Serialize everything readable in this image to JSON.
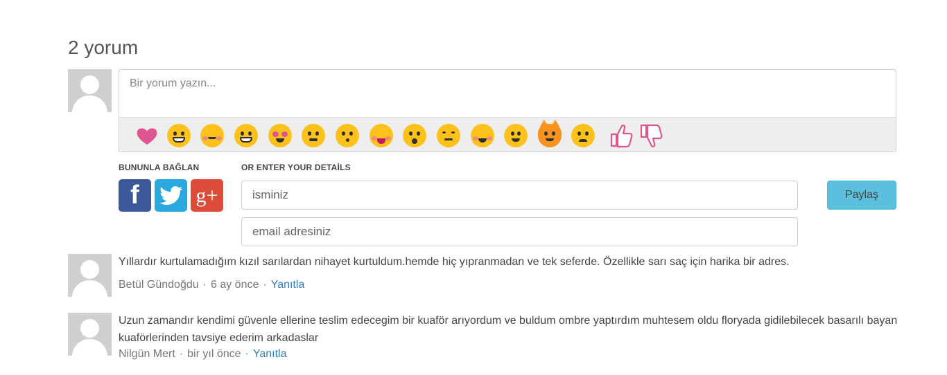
{
  "header": {
    "title": "2 yorum"
  },
  "compose": {
    "placeholder": "Bir yorum yazın...",
    "emojis": [
      "heart-icon",
      "anguished-face-icon",
      "sleepy-face-icon",
      "grinning-face-icon",
      "heart-eyes-face-icon",
      "confounded-face-icon",
      "kissing-face-icon",
      "laughing-face-icon",
      "surprised-face-icon",
      "angry-face-icon",
      "blushing-face-icon",
      "smiling-face-icon",
      "cat-face-icon",
      "worried-face-icon",
      "thumbs-up-icon",
      "thumbs-down-icon"
    ]
  },
  "connect": {
    "social_label": "BUNUNLA BAĞLAN",
    "details_label": "OR ENTER YOUR DETAİLS",
    "facebook_glyph": "f",
    "google_glyph": "g+"
  },
  "form": {
    "name_placeholder": "isminiz",
    "email_placeholder": "email adresiniz",
    "submit_label": "Paylaş"
  },
  "comments": [
    {
      "text": "Yıllardır kurtulamadığım kızıl sarılardan nihayet kurtuldum.hemde hiç yıpranmadan ve tek seferde. Özellikle sarı saç için harika bir adres.",
      "author": "Betül Gündoğdu",
      "time": "6 ay önce",
      "reply": "Yanıtla"
    },
    {
      "text": "Uzun zamandır kendimi güvenle ellerine teslim edecegim bir kuaför arıyordum ve buldum ombre yaptırdım muhtesem oldu floryada gidilebilecek basarılı bayan kuaförlerinden tavsiye ederim arkadaslar",
      "author": "Nilgün Mert",
      "time": "bir yıl önce",
      "reply": "Yanıtla"
    }
  ],
  "colors": {
    "facebook": "#3b5998",
    "twitter": "#2aa9e0",
    "google": "#dd4b39",
    "share_button": "#5bc0de",
    "link": "#337ab7"
  }
}
